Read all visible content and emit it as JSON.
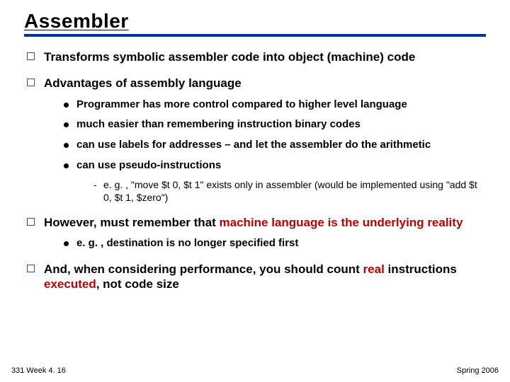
{
  "title": "Assembler",
  "bullets": {
    "b0": "Transforms symbolic assembler code into object (machine) code",
    "b1": "Advantages of assembly language",
    "b1_sub": {
      "s0": "Programmer has more control compared to higher level language",
      "s1": "much easier than remembering instruction binary codes",
      "s2": "can use labels for addresses – and let the assembler do the arithmetic",
      "s3": "can use pseudo-instructions",
      "s3_sub": "e. g. , \"move $t 0, $t 1\" exists only in assembler (would be implemented using \"add $t 0, $t 1, $zero\")"
    },
    "b2_pre": "However, must remember that ",
    "b2_em": "machine language is the underlying reality",
    "b2_sub": "e. g. , destination is no longer specified first",
    "b3_pre": "And, when considering performance, you should count ",
    "b3_em1": "real",
    "b3_mid": " instructions ",
    "b3_em2": "executed",
    "b3_post": ", not code size"
  },
  "footer": {
    "left": "331 Week 4. 16",
    "right": "Spring 2006"
  }
}
